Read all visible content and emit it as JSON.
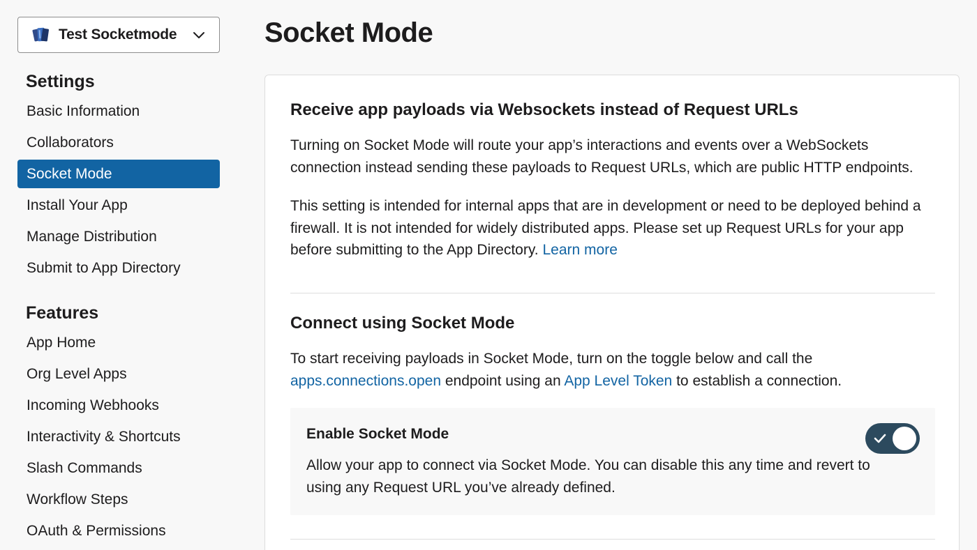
{
  "app_switcher": {
    "name": "Test Socketmode"
  },
  "sidebar": {
    "settings_title": "Settings",
    "settings_items": [
      {
        "label": "Basic Information"
      },
      {
        "label": "Collaborators"
      },
      {
        "label": "Socket Mode",
        "active": true
      },
      {
        "label": "Install Your App"
      },
      {
        "label": "Manage Distribution"
      },
      {
        "label": "Submit to App Directory"
      }
    ],
    "features_title": "Features",
    "features_items": [
      {
        "label": "App Home"
      },
      {
        "label": "Org Level Apps"
      },
      {
        "label": "Incoming Webhooks"
      },
      {
        "label": "Interactivity & Shortcuts"
      },
      {
        "label": "Slash Commands"
      },
      {
        "label": "Workflow Steps"
      },
      {
        "label": "OAuth & Permissions"
      }
    ]
  },
  "main": {
    "title": "Socket Mode",
    "section1": {
      "heading": "Receive app payloads via Websockets instead of Request URLs",
      "para1": "Turning on Socket Mode will route your app’s interactions and events over a WebSockets connection instead sending these payloads to Request URLs, which are public HTTP endpoints.",
      "para2": "This setting is intended for internal apps that are in development or need to be deployed behind a firewall. It is not intended for widely distributed apps. Please set up Request URLs for your app before submitting to the App Directory.",
      "learn_more": "Learn more"
    },
    "section2": {
      "heading": "Connect using Socket Mode",
      "text_before": "To start receiving payloads in Socket Mode, turn on the toggle below and call the",
      "link_endpoint": "apps.connections.open",
      "text_middle": "endpoint using an",
      "link_token": "App Level Token",
      "text_after": "to establish a connection."
    },
    "toggle_panel": {
      "label": "Enable Socket Mode",
      "description": "Allow your app to connect via Socket Mode. You can disable this any time and revert to using any Request URL you’ve already defined.",
      "enabled": true
    }
  },
  "colors": {
    "accent": "#1264a3",
    "toggle_on": "#2c4a5e",
    "page_bg": "#f8f8f8"
  }
}
